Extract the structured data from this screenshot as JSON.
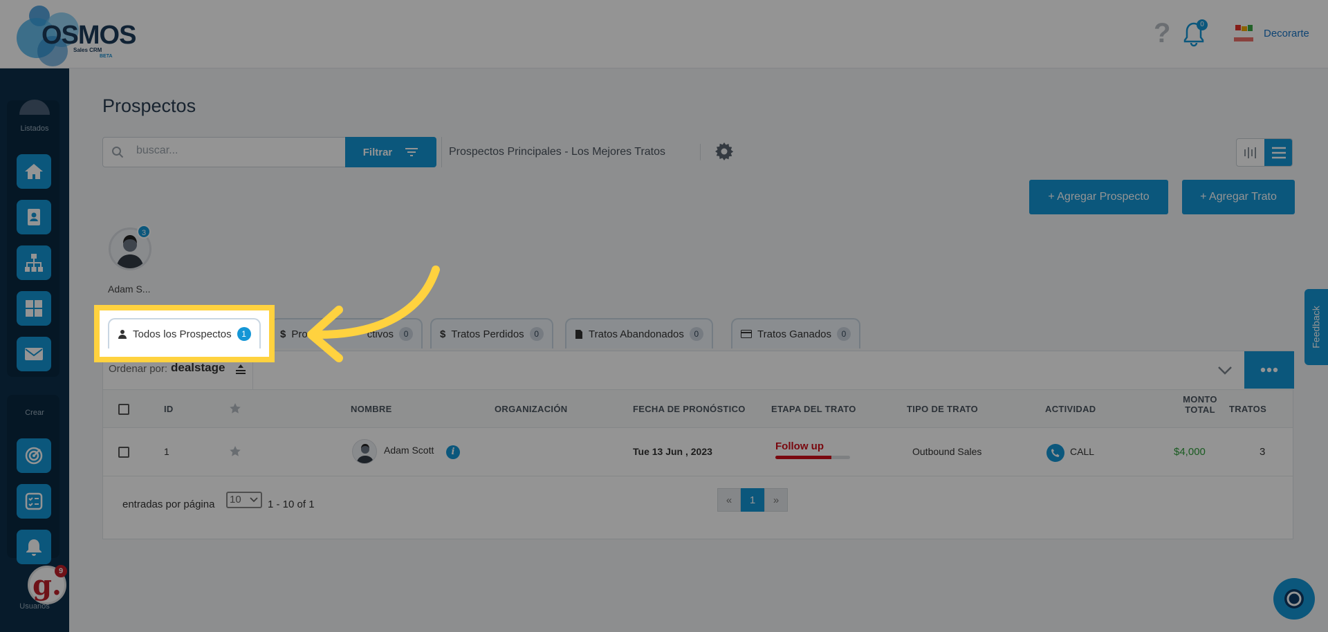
{
  "header": {
    "logo_word": "OSMOS",
    "logo_sub": "Sales CRM",
    "logo_beta": "BETA",
    "help_symbol": "?",
    "notifications_count": "0",
    "company_name": "Decorarte"
  },
  "sidebar": {
    "group1_label": "Listados",
    "group2_label": "Crear",
    "group3_label": "Usuarios",
    "items": [
      {
        "icon": "home-icon"
      },
      {
        "icon": "contact-card-icon"
      },
      {
        "icon": "org-chart-icon"
      },
      {
        "icon": "grid-icon"
      },
      {
        "icon": "mail-icon"
      },
      {
        "icon": "target-icon"
      },
      {
        "icon": "checklist-icon"
      },
      {
        "icon": "bell-alert-icon"
      }
    ],
    "g_badge_letter": "g.",
    "g_badge_count": "9"
  },
  "page": {
    "title": "Prospectos",
    "search_placeholder": "buscar...",
    "filter_label": "Filtrar",
    "pipeline_name": "Prospectos Principales - Los Mejores Tratos",
    "add_prospect": "+ Agregar Prospecto",
    "add_deal": "+ Agregar Trato"
  },
  "owner": {
    "name": "Adam S...",
    "count": "3"
  },
  "tabs": [
    {
      "label": "Todos los Prospectos",
      "count": "1"
    },
    {
      "label": "Prospectos Activos",
      "visible_left": "Pro",
      "visible_right": "ctivos",
      "count": "0"
    },
    {
      "label": "Tratos Perdidos",
      "count": "0"
    },
    {
      "label": "Tratos Abandonados",
      "count": "0"
    },
    {
      "label": "Tratos Ganados",
      "count": "0"
    }
  ],
  "sort": {
    "label": "Ordenar por:",
    "field": "dealstage"
  },
  "table": {
    "headers": {
      "id": "ID",
      "name": "NOMBRE",
      "org": "ORGANIZACIÓN",
      "forecast": "FECHA DE PRONÓSTICO",
      "stage": "ETAPA DEL TRATO",
      "deal_type": "TIPO DE TRATO",
      "activity": "ACTIVIDAD",
      "amount_line1": "MONTO",
      "amount_line2": "TOTAL",
      "deals": "TRATOS"
    },
    "rows": [
      {
        "id": "1",
        "name": "Adam Scott",
        "org": "",
        "forecast": "Tue 13 Jun , 2023",
        "stage": "Follow up",
        "stage_progress": 0.75,
        "deal_type": "Outbound Sales",
        "activity": "CALL",
        "amount": "$4,000",
        "deals": "3"
      }
    ]
  },
  "pagination": {
    "per_page_label": "entradas por página",
    "per_page_value": "10",
    "range": "1 - 10 of 1",
    "prev": "«",
    "current": "1",
    "next": "»"
  },
  "feedback_label": "Feedback",
  "colors": {
    "accent": "#1496d6",
    "sidebar": "#0d2f4a",
    "highlight": "#ffd23f",
    "amount": "#2e9e3a",
    "stage": "#d10f1b"
  }
}
